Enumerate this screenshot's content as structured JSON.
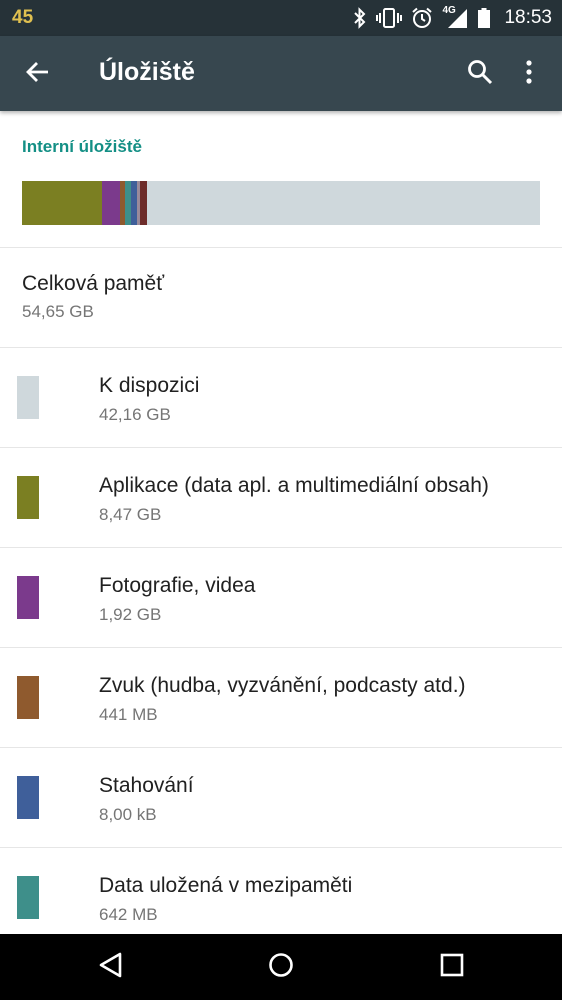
{
  "status_bar": {
    "battery_level": "45",
    "network_type": "4G",
    "time": "18:53",
    "icons": [
      "bluetooth-icon",
      "vibrate-icon",
      "alarm-icon",
      "signal-icon",
      "battery-icon"
    ]
  },
  "app_bar": {
    "title": "Úložiště",
    "icons": [
      "back-arrow-icon",
      "search-icon",
      "more-vert-icon"
    ]
  },
  "section": {
    "header": "Interní úložiště"
  },
  "storage_bar": {
    "background_color": "#cfd8dc",
    "segments": [
      {
        "name": "Aplikace",
        "fraction": 0.155,
        "color": "#7b7f22"
      },
      {
        "name": "Fotografie, videa",
        "fraction": 0.035,
        "color": "#7b3a8c"
      },
      {
        "name": "Zvuk",
        "fraction": 0.008,
        "color": "#8f5a2e"
      },
      {
        "name": "Data uložená v mezipaměti",
        "fraction": 0.012,
        "color": "#3e8f8a"
      },
      {
        "name": "Stahování",
        "fraction": 0.012,
        "color": "#3f5f9a"
      },
      {
        "name": "Ostatní",
        "fraction": 0.006,
        "color": "#9a8a9a"
      },
      {
        "name": "Systém",
        "fraction": 0.014,
        "color": "#6d2c2a"
      }
    ]
  },
  "total": {
    "label": "Celková paměť",
    "value": "54,65 GB"
  },
  "categories": [
    {
      "label": "K dispozici",
      "value": "42,16 GB",
      "color": "#cfd8dc"
    },
    {
      "label": "Aplikace (data apl. a multimediální obsah)",
      "value": "8,47 GB",
      "color": "#7b7f22"
    },
    {
      "label": "Fotografie, videa",
      "value": "1,92 GB",
      "color": "#7b3a8c"
    },
    {
      "label": "Zvuk (hudba, vyzvánění, podcasty atd.)",
      "value": "441 MB",
      "color": "#8f5a2e"
    },
    {
      "label": "Stahování",
      "value": "8,00 kB",
      "color": "#3f5f9a"
    },
    {
      "label": "Data uložená v mezipaměti",
      "value": "642 MB",
      "color": "#3e8f8a"
    }
  ],
  "nav_bar": {
    "icons": [
      "back-triangle-icon",
      "home-circle-icon",
      "recents-square-icon"
    ]
  }
}
